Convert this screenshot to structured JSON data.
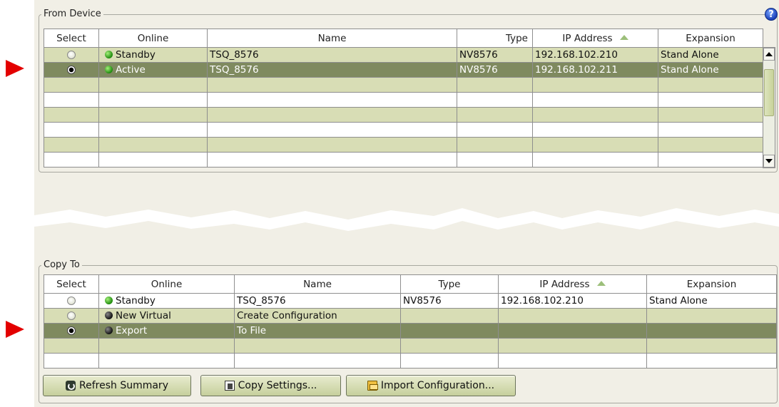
{
  "from_device": {
    "legend": "From Device",
    "help_icon": "help-icon",
    "columns": [
      "Select",
      "Online",
      "Name",
      "Type",
      "IP Address",
      "Expansion"
    ],
    "sorted_column": "IP Address",
    "rows": [
      {
        "selected": false,
        "status": "green",
        "online": "Standby",
        "name": "TSQ_8576",
        "type": "NV8576",
        "ip": "192.168.102.210",
        "expansion": "Stand Alone"
      },
      {
        "selected": true,
        "status": "green",
        "online": "Active",
        "name": "TSQ_8576",
        "type": "NV8576",
        "ip": "192.168.102.211",
        "expansion": "Stand Alone"
      }
    ]
  },
  "copy_to": {
    "legend": "Copy To",
    "columns": [
      "Select",
      "Online",
      "Name",
      "Type",
      "IP Address",
      "Expansion"
    ],
    "sorted_column": "IP Address",
    "rows": [
      {
        "selected": false,
        "status": "green",
        "online": "Standby",
        "name": "TSQ_8576",
        "type": "NV8576",
        "ip": "192.168.102.210",
        "expansion": "Stand Alone"
      },
      {
        "selected": false,
        "status": "dark",
        "online": "New Virtual",
        "name": "Create Configuration",
        "type": "",
        "ip": "",
        "expansion": ""
      },
      {
        "selected": true,
        "status": "dark",
        "online": "Export",
        "name": "To File",
        "type": "",
        "ip": "",
        "expansion": ""
      }
    ]
  },
  "buttons": {
    "refresh": "Refresh Summary",
    "copy": "Copy Settings...",
    "import": "Import Configuration..."
  },
  "colors": {
    "pointer": "#e30000",
    "row_alt": "#d8ddb5",
    "row_selected": "#7f8a5f",
    "panel": "#f1efe6"
  }
}
